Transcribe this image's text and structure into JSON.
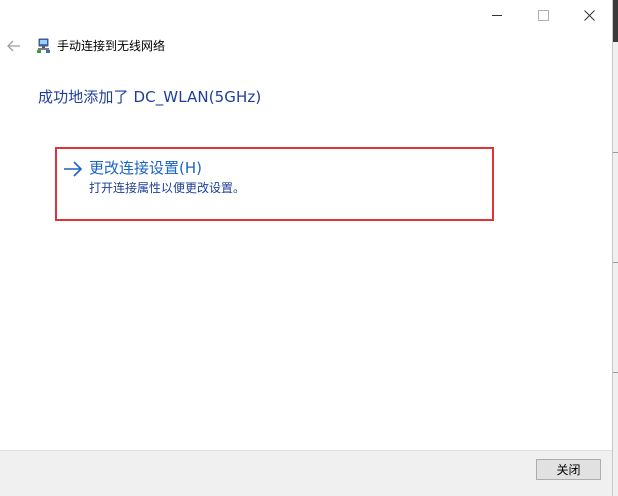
{
  "window": {
    "controls": {
      "minimize_icon": "minimize-icon",
      "maximize_icon": "maximize-icon",
      "close_icon": "close-icon"
    }
  },
  "header": {
    "back_icon": "back-arrow-icon",
    "app_icon": "network-icon",
    "title": "手动连接到无线网络"
  },
  "main": {
    "heading": "成功地添加了 DC_WLAN(5GHz)",
    "option": {
      "icon": "right-arrow-icon",
      "label": "更改连接设置(H)",
      "description": "打开连接属性以便更改设置。"
    }
  },
  "footer": {
    "close_label": "关闭"
  },
  "colors": {
    "heading": "#1f3e99",
    "link": "#1a64c6",
    "highlight_border": "#e0323a",
    "footer_bg": "#f0f0f0"
  }
}
